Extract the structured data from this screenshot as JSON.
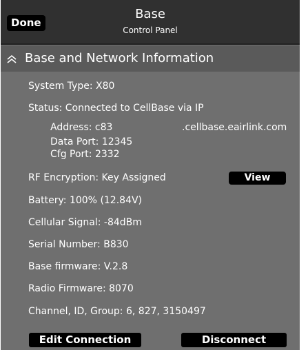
{
  "header": {
    "done_label": "Done",
    "title": "Base",
    "subtitle": "Control Panel"
  },
  "section": {
    "title": "Base and Network Information",
    "icon": "double-chevron-up-icon"
  },
  "info": {
    "system_type": "System Type: X80",
    "status": "Status: Connected to CellBase via IP",
    "address_label": "Address: c83",
    "address_host": ".cellbase.eairlink.com",
    "data_port": "Data Port: 12345",
    "cfg_port": "Cfg Port: 2332",
    "rf_encryption": "RF Encryption: Key Assigned",
    "battery": "Battery:  100% (12.84V)",
    "cellular_signal": "Cellular Signal: -84dBm",
    "serial_number": "Serial Number: B830",
    "base_firmware": "Base firmware: V.2.8",
    "radio_firmware": "Radio Firmware: 8070",
    "channel_id_group": "Channel, ID, Group:   6, 827, 3150497"
  },
  "buttons": {
    "view": "View",
    "edit_connection": "Edit Connection",
    "disconnect": "Disconnect"
  },
  "colors": {
    "panel_bg": "#6f6f6f",
    "titlebar_bg": "#303030",
    "button_bg": "#000000",
    "text": "#ffffff"
  }
}
